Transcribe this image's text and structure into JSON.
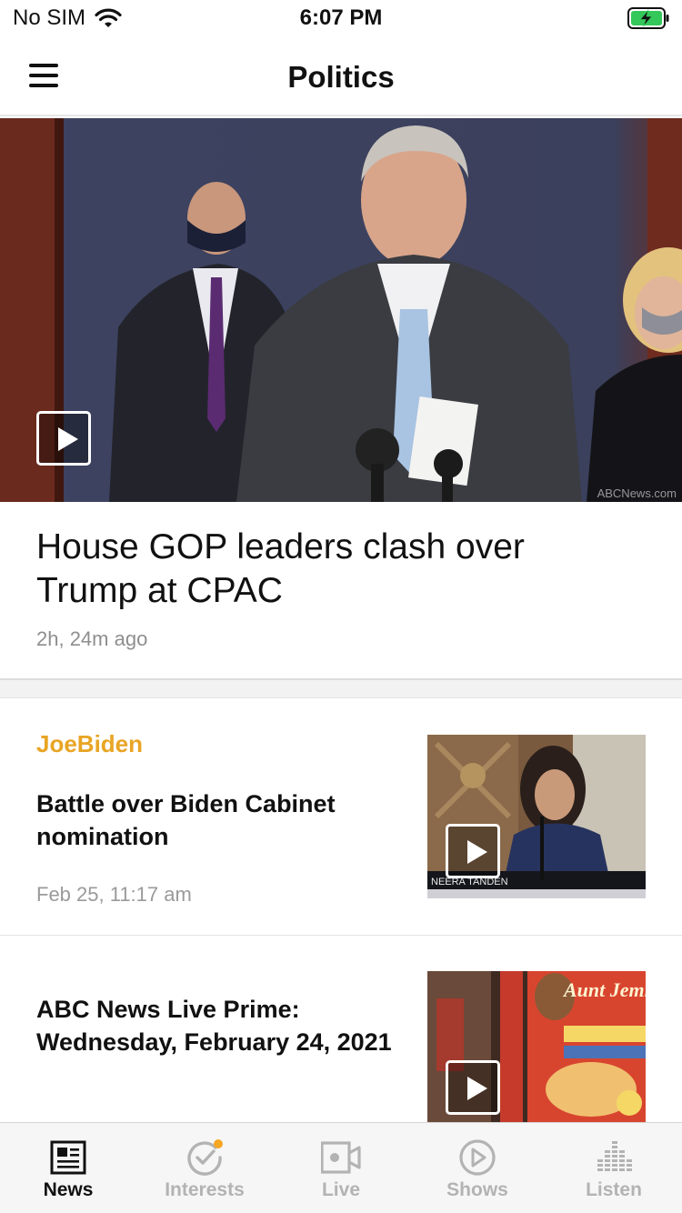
{
  "status_bar": {
    "carrier": "No SIM",
    "time": "6:07 PM"
  },
  "header": {
    "title": "Politics"
  },
  "hero": {
    "headline": "House GOP leaders clash over Trump at CPAC",
    "timestamp": "2h, 24m ago",
    "watermark": "ABCNews.com"
  },
  "stories": [
    {
      "tag": "JoeBiden",
      "title": "Battle over Biden Cabinet nomination",
      "timestamp": "Feb 25, 11:17 am",
      "thumb_caption": "NEERA TANDEN"
    },
    {
      "title": "ABC News Live Prime: Wednesday, February 24, 2021",
      "thumb_caption": "Aunt Jemima"
    }
  ],
  "tab_bar": {
    "tabs": [
      {
        "label": "News",
        "icon": "newspaper-icon",
        "active": true
      },
      {
        "label": "Interests",
        "icon": "interests-check-icon",
        "active": false
      },
      {
        "label": "Live",
        "icon": "video-camera-icon",
        "active": false
      },
      {
        "label": "Shows",
        "icon": "play-circle-icon",
        "active": false
      },
      {
        "label": "Listen",
        "icon": "audio-bars-icon",
        "active": false
      }
    ]
  },
  "colors": {
    "accent": "#e8a524",
    "battery": "#34c759",
    "muted": "#8e8e8e",
    "notification_dot": "#f5a623"
  }
}
